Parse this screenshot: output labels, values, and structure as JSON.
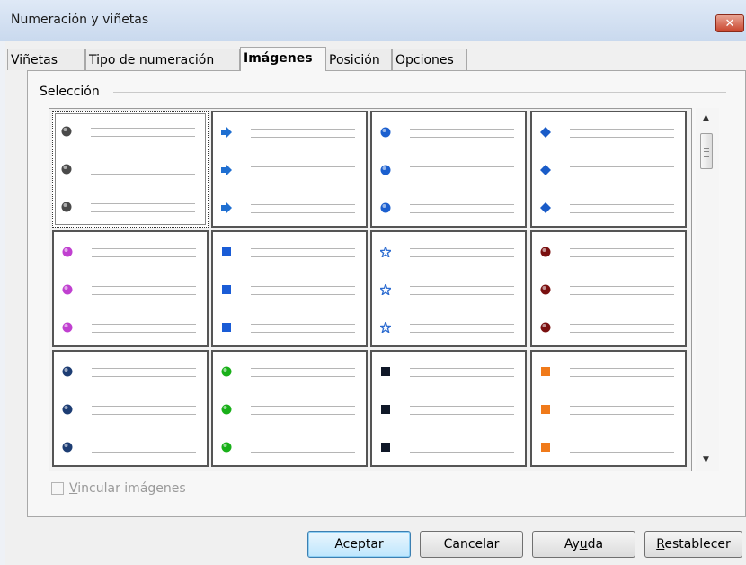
{
  "window": {
    "title": "Numeración y viñetas",
    "close_label": "✕"
  },
  "tabs": [
    {
      "label": "Viñetas"
    },
    {
      "label": "Tipo de numeración"
    },
    {
      "label": "Imágenes"
    },
    {
      "label": "Posición"
    },
    {
      "label": "Opciones"
    }
  ],
  "active_tab": "Imágenes",
  "selection": {
    "label": "Selección",
    "selected_index": 0,
    "bullets": [
      {
        "icon": "gray-sphere-bullet",
        "color": "#4a4a4a",
        "shape": "circle"
      },
      {
        "icon": "blue-arrow-bullet",
        "color": "#1f6fd1",
        "shape": "arrow"
      },
      {
        "icon": "blue-sphere-bullet",
        "color": "#1b5fcf",
        "shape": "circle"
      },
      {
        "icon": "blue-diamond-bullet",
        "color": "#1a5cc8",
        "shape": "diamond"
      },
      {
        "icon": "pink-sphere-bullet",
        "color": "#c040d0",
        "shape": "circle"
      },
      {
        "icon": "blue-cube-bullet",
        "color": "#1a5cd6",
        "shape": "square"
      },
      {
        "icon": "blue-star-bullet",
        "color": "#2a6ad0",
        "shape": "star"
      },
      {
        "icon": "dark-red-sphere-bullet",
        "color": "#7a1010",
        "shape": "circle"
      },
      {
        "icon": "navy-sphere-bullet",
        "color": "#1d3d73",
        "shape": "circle"
      },
      {
        "icon": "green-sphere-bullet",
        "color": "#19b019",
        "shape": "circle"
      },
      {
        "icon": "black-square-bullet",
        "color": "#101828",
        "shape": "square"
      },
      {
        "icon": "orange-square-bullet",
        "color": "#f07a1a",
        "shape": "square"
      }
    ]
  },
  "link_images": {
    "label_mnemonic": "V",
    "label_rest": "incular imágenes",
    "checked": false,
    "enabled": false
  },
  "buttons": {
    "ok": "Aceptar",
    "cancel": "Cancelar",
    "help_pre": "Ay",
    "help_mnemonic": "u",
    "help_post": "da",
    "reset_mnemonic": "R",
    "reset_rest": "establecer"
  }
}
